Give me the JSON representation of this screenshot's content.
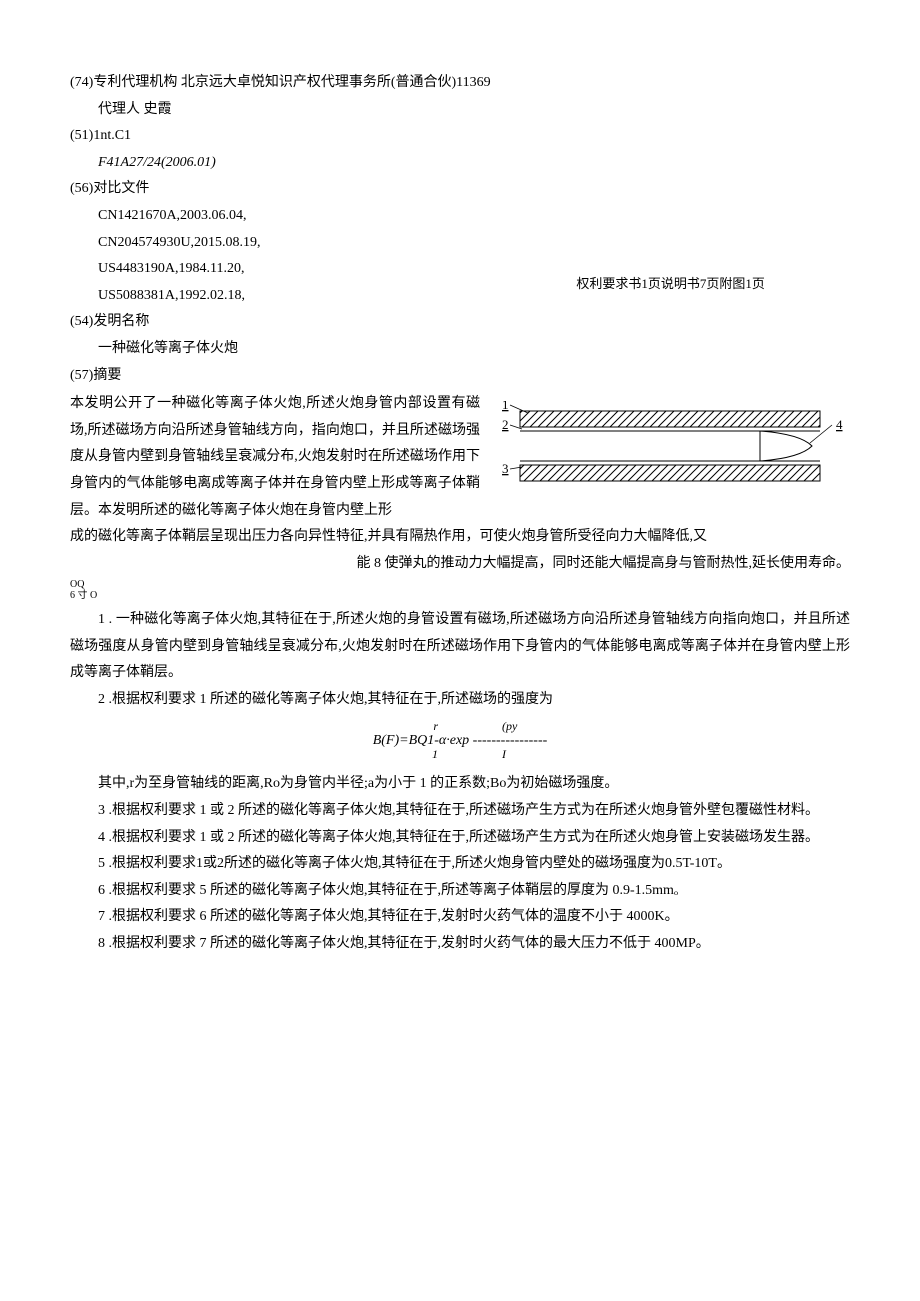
{
  "biblio": {
    "agency_label": "(74)专利代理机构",
    "agency_value": "北京远大卓悦知识产权代理事务所(普通合伙)11369",
    "agent_label": "代理人",
    "agent_value": "史霞",
    "intcl_label": "(51)1nt.C1",
    "intcl_value": "F41A27/24(2006.01)",
    "cited_label": "(56)对比文件",
    "cited": [
      "CN1421670A,2003.06.04,",
      "CN204574930U,2015.08.19,",
      "US4483190A,1984.11.20,",
      "US5088381A,1992.02.18,"
    ],
    "page_counts": "权利要求书1页说明书7页附图1页",
    "title_label": "(54)发明名称",
    "title_value": "一种磁化等离子体火炮",
    "abstract_label": "(57)摘要"
  },
  "abstract": {
    "p1": "本发明公开了一种磁化等离子体火炮,所述火炮身管内部设置有磁场,所述磁场方向沿所述身管轴线方向，指向炮口，并且所述磁场强度从身管内壁到身管轴线呈衰减分布,火炮发射时在所述磁场作用下身管内的气体能够电离成等离子体并在身管内壁上形成等离子体鞘层。本发明所述的磁化等离子体火炮在身管内壁上形",
    "p2": "成的磁化等离子体鞘层呈现出压力各向异性特征,并具有隔热作用，可使火炮身管所受径向力大幅降低,又",
    "p3": "能 8 使弹丸的推动力大幅提高，同时还能大幅提高身与管耐热性,延长使用寿命。"
  },
  "side_note": {
    "l1": "OQ",
    "l2": "6 寸 O"
  },
  "figure": {
    "labels": [
      "1",
      "2",
      "3",
      "4"
    ]
  },
  "claims": {
    "c1": "1    . 一种磁化等离子体火炮,其特征在于,所述火炮的身管设置有磁场,所述磁场方向沿所述身管轴线方向指向炮口，并且所述磁场强度从身管内壁到身管轴线呈衰减分布,火炮发射时在所述磁场作用下身管内的气体能够电离成等离子体并在身管内壁上形成等离子体鞘层。",
    "c2": "2       .根据权利要求 1 所述的磁化等离子体火炮,其特征在于,所述磁场的强度为",
    "formula_top_left": "r",
    "formula_top_right": "(py",
    "formula_mid": "B(F)=BQ1-α·exp ----------------",
    "formula_bot_left": "1",
    "formula_bot_right": "I",
    "c2b": "其中,r为至身管轴线的距离,Ro为身管内半径;a为小于 1 的正系数;Bo为初始磁场强度。",
    "c3": "3    .根据权利要求 1 或 2 所述的磁化等离子体火炮,其特征在于,所述磁场产生方式为在所述火炮身管外壁包覆磁性材料。",
    "c4": "4    .根据权利要求 1 或 2 所述的磁化等离子体火炮,其特征在于,所述磁场产生方式为在所述火炮身管上安装磁场发生器。",
    "c5": "5    .根据权利要求1或2所述的磁化等离子体火炮,其特征在于,所述火炮身管内壁处的磁场强度为0.5T-10T。",
    "c6": "6    .根据权利要求 5 所述的磁化等离子体火炮,其特征在于,所述等离子体鞘层的厚度为 0.9-1.5mmₒ",
    "c7": "7    .根据权利要求 6 所述的磁化等离子体火炮,其特征在于,发射时火药气体的温度不小于 4000K。",
    "c8": "8    .根据权利要求 7 所述的磁化等离子体火炮,其特征在于,发射时火药气体的最大压力不低于 400MP。"
  }
}
